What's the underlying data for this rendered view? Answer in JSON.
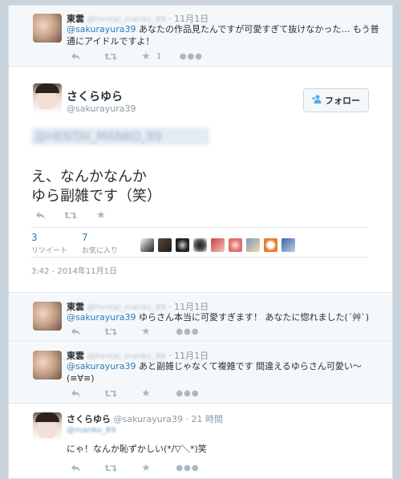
{
  "top_reply": {
    "name": "東雲",
    "handle": "@hentai_manko_89",
    "sep": "·",
    "time": "11月1日",
    "mention": "@sakurayura39",
    "text1": " あなたの作品見たんですが可愛すぎて抜けなかった… もう普",
    "text2": "通にアイドルですよ！",
    "fav_count": "1"
  },
  "main_tweet": {
    "name": "さくらゆら",
    "handle": "@sakurayura39",
    "follow_label": "フォロー",
    "follow_icon": "person-plus-icon",
    "blurred_mention": "@HENTAI_MANKO_89",
    "text_line1": "え、なんかなんか",
    "text_line2": "ゆら副雑です（笑）",
    "retweets_count": "3",
    "retweets_label": "リツイート",
    "favorites_count": "7",
    "favorites_label": "お気に入り",
    "date": "3:42 - 2014年11月1日"
  },
  "replies": [
    {
      "name": "東雲",
      "handle": "@hentai_manko_89",
      "sep": "·",
      "time": "11月1日",
      "mention": "@sakurayura39",
      "text1": " ゆらさん本当に可愛すぎます！ あなたに惚れました(´艸`)",
      "text2": ""
    },
    {
      "name": "東雲",
      "handle": "@hentai_manko_89",
      "sep": "·",
      "time": "11月1日",
      "mention": "@sakurayura39",
      "text1": " あと副雑じゃなくて複雑です 間違えるゆらさん可愛い～",
      "text2": "(≡∀≡)"
    },
    {
      "name": "さくらゆら",
      "handle": "@sakurayura39",
      "sep": "·",
      "time": "21 時間",
      "blurred_mention": "@manko_89",
      "text1": "にゃ！なんか恥ずかしい(*/▽＼*)笑",
      "text2": ""
    }
  ],
  "icons": {
    "reply": "reply-icon",
    "retweet": "retweet-icon",
    "favorite": "star-icon",
    "more": "more-icon"
  },
  "colors": {
    "link": "#2b7bb9",
    "muted": "#8899a6",
    "reply_bg": "#f5f8fa",
    "page_bg": "#c9d3dc"
  }
}
